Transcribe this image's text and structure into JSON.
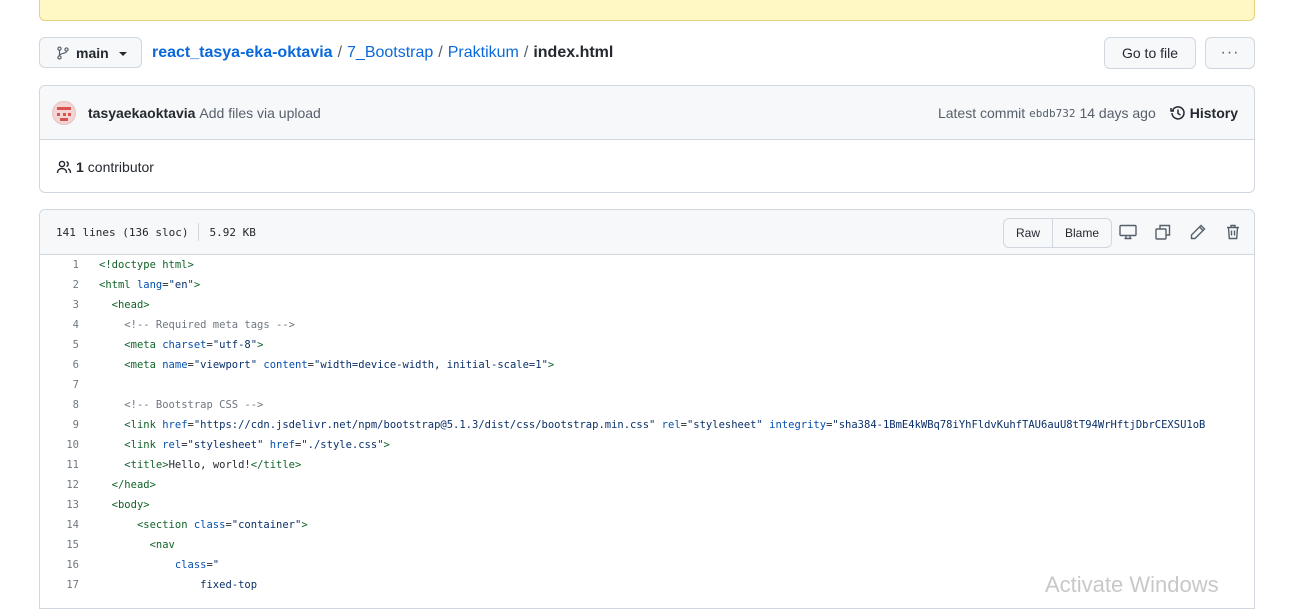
{
  "branch": {
    "name": "main"
  },
  "breadcrumb": {
    "repo": "react_tasya-eka-oktavia",
    "sep": "/",
    "parts": [
      "7_Bootstrap",
      "Praktikum"
    ],
    "file": "index.html"
  },
  "actions": {
    "go_to_file": "Go to file",
    "more": "···"
  },
  "commit": {
    "author": "tasyaekaoktavia",
    "message": "Add files via upload",
    "latest_label": "Latest commit",
    "sha": "ebdb732",
    "time": "14 days ago",
    "history_label": "History"
  },
  "contributors": {
    "count": "1",
    "label": "contributor"
  },
  "file_info": {
    "lines": "141 lines (136 sloc)",
    "size": "5.92 KB",
    "raw_label": "Raw",
    "blame_label": "Blame"
  },
  "icons": {
    "branch": "git-branch-icon",
    "history": "clock-history-icon",
    "people": "people-icon",
    "desktop": "desktop-icon",
    "copy": "copy-icon",
    "edit": "pencil-icon",
    "delete": "trash-icon"
  },
  "code_lines": [
    {
      "n": "1",
      "tokens": [
        [
          "tag",
          "<!doctype html>"
        ]
      ]
    },
    {
      "n": "2",
      "tokens": [
        [
          "tag",
          "<html"
        ],
        [
          "txt",
          " "
        ],
        [
          "attr",
          "lang"
        ],
        [
          "txt",
          "="
        ],
        [
          "str",
          "\"en\""
        ],
        [
          "tag",
          ">"
        ]
      ]
    },
    {
      "n": "3",
      "tokens": [
        [
          "txt",
          "  "
        ],
        [
          "tag",
          "<head>"
        ]
      ]
    },
    {
      "n": "4",
      "tokens": [
        [
          "txt",
          "    "
        ],
        [
          "cmt",
          "<!-- Required meta tags -->"
        ]
      ]
    },
    {
      "n": "5",
      "tokens": [
        [
          "txt",
          "    "
        ],
        [
          "tag",
          "<meta"
        ],
        [
          "txt",
          " "
        ],
        [
          "attr",
          "charset"
        ],
        [
          "txt",
          "="
        ],
        [
          "str",
          "\"utf-8\""
        ],
        [
          "tag",
          ">"
        ]
      ]
    },
    {
      "n": "6",
      "tokens": [
        [
          "txt",
          "    "
        ],
        [
          "tag",
          "<meta"
        ],
        [
          "txt",
          " "
        ],
        [
          "attr",
          "name"
        ],
        [
          "txt",
          "="
        ],
        [
          "str",
          "\"viewport\""
        ],
        [
          "txt",
          " "
        ],
        [
          "attr",
          "content"
        ],
        [
          "txt",
          "="
        ],
        [
          "str",
          "\"width=device-width, initial-scale=1\""
        ],
        [
          "tag",
          ">"
        ]
      ]
    },
    {
      "n": "7",
      "tokens": []
    },
    {
      "n": "8",
      "tokens": [
        [
          "txt",
          "    "
        ],
        [
          "cmt",
          "<!-- Bootstrap CSS -->"
        ]
      ]
    },
    {
      "n": "9",
      "tokens": [
        [
          "txt",
          "    "
        ],
        [
          "tag",
          "<link"
        ],
        [
          "txt",
          " "
        ],
        [
          "attr",
          "href"
        ],
        [
          "txt",
          "="
        ],
        [
          "str",
          "\"https://cdn.jsdelivr.net/npm/bootstrap@5.1.3/dist/css/bootstrap.min.css\""
        ],
        [
          "txt",
          " "
        ],
        [
          "attr",
          "rel"
        ],
        [
          "txt",
          "="
        ],
        [
          "str",
          "\"stylesheet\""
        ],
        [
          "txt",
          " "
        ],
        [
          "attr",
          "integrity"
        ],
        [
          "txt",
          "="
        ],
        [
          "str",
          "\"sha384-1BmE4kWBq78iYhFldvKuhfTAU6auU8tT94WrHftjDbrCEXSU1oB"
        ]
      ]
    },
    {
      "n": "10",
      "tokens": [
        [
          "txt",
          "    "
        ],
        [
          "tag",
          "<link"
        ],
        [
          "txt",
          " "
        ],
        [
          "attr",
          "rel"
        ],
        [
          "txt",
          "="
        ],
        [
          "str",
          "\"stylesheet\""
        ],
        [
          "txt",
          " "
        ],
        [
          "attr",
          "href"
        ],
        [
          "txt",
          "="
        ],
        [
          "str",
          "\"./style.css\""
        ],
        [
          "tag",
          ">"
        ]
      ]
    },
    {
      "n": "11",
      "tokens": [
        [
          "txt",
          "    "
        ],
        [
          "tag",
          "<title>"
        ],
        [
          "txt",
          "Hello, world!"
        ],
        [
          "tag",
          "</title>"
        ]
      ]
    },
    {
      "n": "12",
      "tokens": [
        [
          "txt",
          "  "
        ],
        [
          "tag",
          "</head>"
        ]
      ]
    },
    {
      "n": "13",
      "tokens": [
        [
          "txt",
          "  "
        ],
        [
          "tag",
          "<body>"
        ]
      ]
    },
    {
      "n": "14",
      "tokens": [
        [
          "txt",
          "      "
        ],
        [
          "tag",
          "<section"
        ],
        [
          "txt",
          " "
        ],
        [
          "attr",
          "class"
        ],
        [
          "txt",
          "="
        ],
        [
          "str",
          "\"container\""
        ],
        [
          "tag",
          ">"
        ]
      ]
    },
    {
      "n": "15",
      "tokens": [
        [
          "txt",
          "        "
        ],
        [
          "tag",
          "<nav"
        ]
      ]
    },
    {
      "n": "16",
      "tokens": [
        [
          "txt",
          "            "
        ],
        [
          "attr",
          "class"
        ],
        [
          "txt",
          "="
        ],
        [
          "str",
          "\""
        ]
      ]
    },
    {
      "n": "17",
      "tokens": [
        [
          "txt",
          "                "
        ],
        [
          "str",
          "fixed-top"
        ]
      ]
    }
  ],
  "watermark": "Activate Windows"
}
